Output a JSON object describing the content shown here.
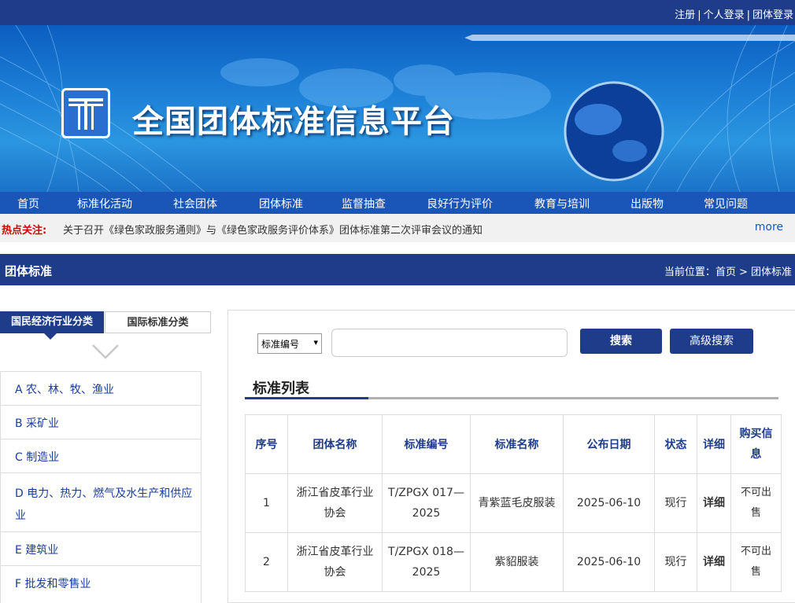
{
  "header": {
    "links": [
      "注册",
      "个人登录",
      "团体登录"
    ],
    "site_title": "全国团体标准信息平台"
  },
  "nav": {
    "items": [
      "首页",
      "标准化活动",
      "社会团体",
      "团体标准",
      "监督抽查",
      "良好行为评价",
      "教育与培训",
      "出版物",
      "常见问题"
    ]
  },
  "hot": {
    "label": "热点关注:",
    "text": "关于召开《绿色家政服务通则》与《绿色家政服务评价体系》团体标准第二次评审会议的通知",
    "more": "more"
  },
  "section": {
    "title": "团体标准",
    "breadcrumb": "当前位置：首页 > 团体标准"
  },
  "sidebar": {
    "tab_active": "国民经济行业分类",
    "tab_inactive": "国际标准分类",
    "categories": [
      {
        "label": "A 农、林、牧、渔业"
      },
      {
        "label": "B 采矿业"
      },
      {
        "label": "C 制造业"
      },
      {
        "label": "D 电力、热力、燃气及水生产和供应业"
      },
      {
        "label": "E 建筑业"
      },
      {
        "label": "F 批发和零售业"
      }
    ]
  },
  "search": {
    "select_value": "标准编号",
    "placeholder": "",
    "search_button": "搜索",
    "advanced_button": "高级搜索"
  },
  "list": {
    "title": "标准列表",
    "columns": [
      "序号",
      "团体名称",
      "标准编号",
      "标准名称",
      "公布日期",
      "状态",
      "详细",
      "购买信息"
    ],
    "rows": [
      {
        "no": "1",
        "org": "浙江省皮革行业协会",
        "code": "T/ZPGX 017—2025",
        "name": "青紫蓝毛皮服装",
        "date": "2025-06-10",
        "status": "现行",
        "detail": "详细",
        "buy": "不可出售"
      },
      {
        "no": "2",
        "org": "浙江省皮革行业协会",
        "code": "T/ZPGX 018—2025",
        "name": "紫貂服装",
        "date": "2025-06-10",
        "status": "现行",
        "detail": "详细",
        "buy": "不可出售"
      }
    ]
  },
  "colors": {
    "brand_dark": "#1f3c8a",
    "nav_blue": "#1a56b8",
    "hot_red": "#d40000"
  }
}
